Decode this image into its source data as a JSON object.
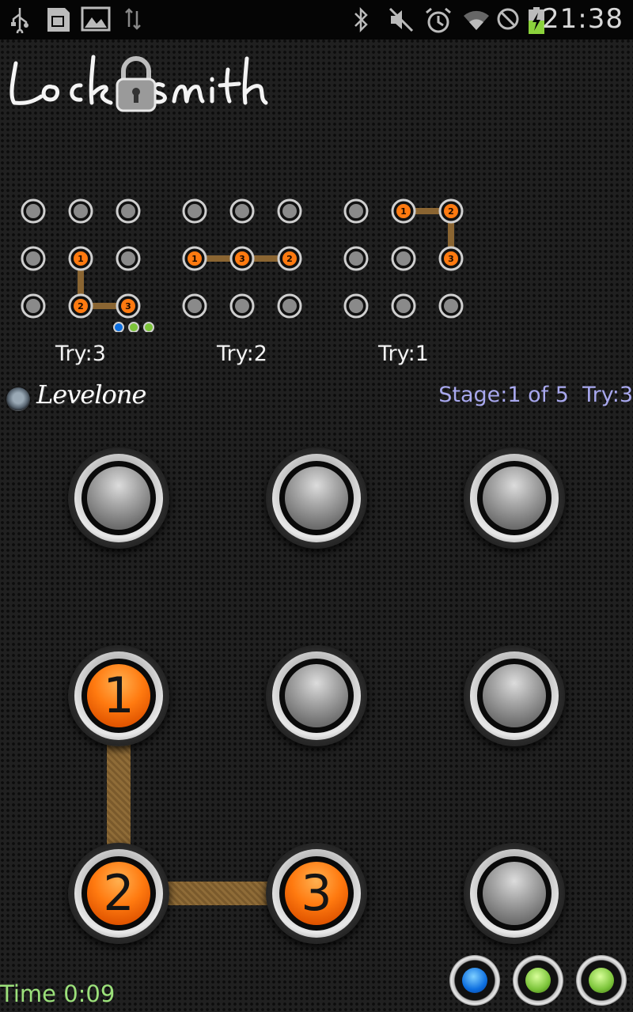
{
  "status_bar": {
    "time": "21:38",
    "icons_left": [
      "usb-icon",
      "sd-card-icon",
      "image-icon",
      "transfer-icon"
    ],
    "icons_right": [
      "bluetooth-icon",
      "mute-icon",
      "alarm-icon",
      "wifi-icon",
      "no-sim-icon",
      "battery-charging-icon"
    ]
  },
  "app": {
    "logo_text": "Locksmith"
  },
  "history": [
    {
      "label": "Try:3",
      "path": [
        4,
        7,
        8
      ]
    },
    {
      "label": "Try:2",
      "path": [
        3,
        5,
        4
      ]
    },
    {
      "label": "Try:1",
      "path": [
        1,
        2,
        5
      ]
    }
  ],
  "history_feedback": [
    "blue",
    "green",
    "green"
  ],
  "level": {
    "name": "Levelone",
    "stage_info": "Stage:1 of 5  Try:3"
  },
  "board": {
    "buttons": [
      {
        "label": "",
        "active": false
      },
      {
        "label": "",
        "active": false
      },
      {
        "label": "",
        "active": false
      },
      {
        "label": "1",
        "active": true
      },
      {
        "label": "",
        "active": false
      },
      {
        "label": "",
        "active": false
      },
      {
        "label": "2",
        "active": true
      },
      {
        "label": "3",
        "active": true
      },
      {
        "label": "",
        "active": false
      }
    ],
    "path": [
      3,
      6,
      7
    ]
  },
  "timer": {
    "text": "Time 0:09"
  },
  "feedback": {
    "dots": [
      "blue",
      "green",
      "green"
    ]
  },
  "colors": {
    "active": "#ff7a10",
    "hint_blue": "#0d6fe0",
    "hint_green": "#7cc43a",
    "stage_text": "#a8a8ee",
    "time_text": "#9be07a"
  }
}
